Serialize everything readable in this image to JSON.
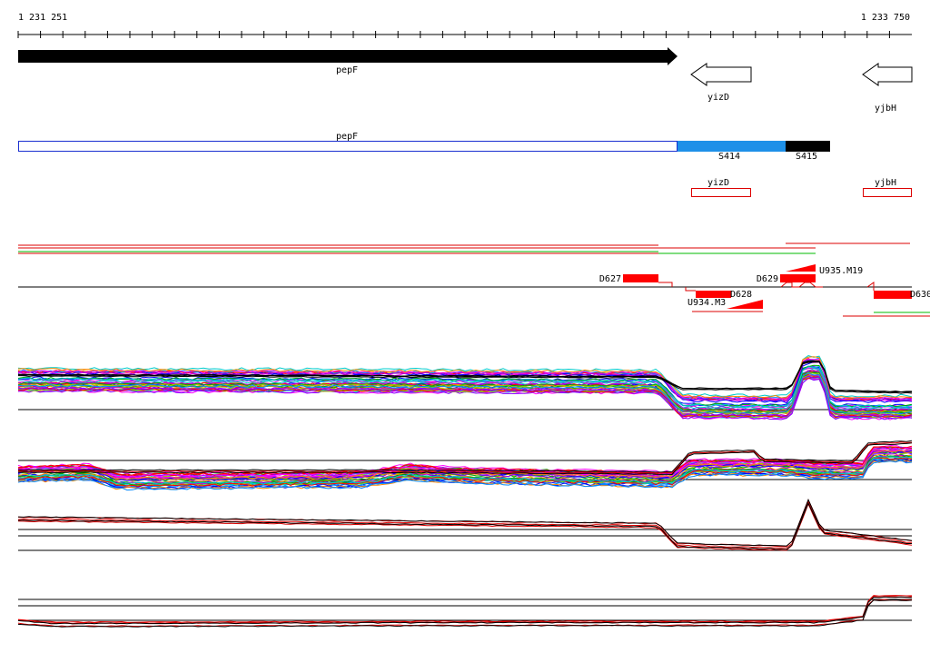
{
  "ruler": {
    "start_label": "1 231 251",
    "end_label": "1 233 750"
  },
  "genes": [
    {
      "name": "pepF",
      "strand": "+"
    },
    {
      "name": "yizD",
      "strand": "-"
    },
    {
      "name": "yjbH",
      "strand": "-"
    }
  ],
  "annotation_track": {
    "main_label": "pepF",
    "segments": [
      {
        "label": "S414",
        "color": "#1e90e8"
      },
      {
        "label": "S415",
        "color": "#000000"
      }
    ],
    "boxes": [
      {
        "label": "yizD",
        "color": "#dd0000"
      },
      {
        "label": "yjbH",
        "color": "#dd0000"
      }
    ]
  },
  "features": {
    "downstream": [
      "D627",
      "D628",
      "D629",
      "D630"
    ],
    "upstream": [
      "U934.M3",
      "U935.M19"
    ],
    "color": "#ff0000"
  },
  "colors": {
    "expression_palette": [
      "#ff00ff",
      "#00aa00",
      "#0000ff",
      "#ff0000",
      "#00cccc",
      "#ff8800",
      "#8800ff",
      "#99cc00",
      "#cc00cc",
      "#0088ff"
    ],
    "red": "#dd0000",
    "black": "#000000",
    "green": "#00bb00"
  }
}
